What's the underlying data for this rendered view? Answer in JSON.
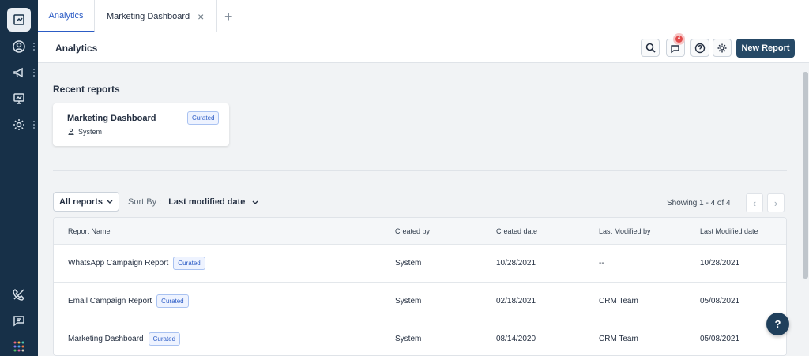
{
  "left_rail": {
    "icons": [
      "analytics-icon",
      "contacts-icon",
      "campaigns-icon",
      "reports-icon",
      "settings-icon",
      "phone-icon",
      "chat-icon",
      "apps-grid-icon"
    ]
  },
  "tabs": [
    {
      "label": "Analytics",
      "active": true
    },
    {
      "label": "Marketing Dashboard",
      "active": false
    }
  ],
  "header": {
    "title": "Analytics",
    "notification_count": "4",
    "new_report_label": "New Report"
  },
  "recent": {
    "title": "Recent reports",
    "cards": [
      {
        "name": "Marketing Dashboard",
        "badge": "Curated",
        "owner": "System"
      }
    ]
  },
  "filters": {
    "all_reports_label": "All reports",
    "sort_label": "Sort By :",
    "sort_value": "Last modified date",
    "showing": "Showing 1 - 4 of 4"
  },
  "table": {
    "headers": [
      "Report Name",
      "Created by",
      "Created date",
      "Last Modified by",
      "Last Modified date"
    ],
    "rows": [
      {
        "name": "WhatsApp Campaign Report",
        "badge": "Curated",
        "created_by": "System",
        "created_date": "10/28/2021",
        "modified_by": "--",
        "modified_date": "10/28/2021"
      },
      {
        "name": "Email Campaign Report",
        "badge": "Curated",
        "created_by": "System",
        "created_date": "02/18/2021",
        "modified_by": "CRM Team",
        "modified_date": "05/08/2021"
      },
      {
        "name": "Marketing Dashboard",
        "badge": "Curated",
        "created_by": "System",
        "created_date": "08/14/2020",
        "modified_by": "CRM Team",
        "modified_date": "05/08/2021"
      }
    ]
  },
  "help_label": "?",
  "colors": {
    "rail": "#173048",
    "accent": "#2c5cc5",
    "primary_button": "#264966",
    "notification": "#e24c4c"
  }
}
